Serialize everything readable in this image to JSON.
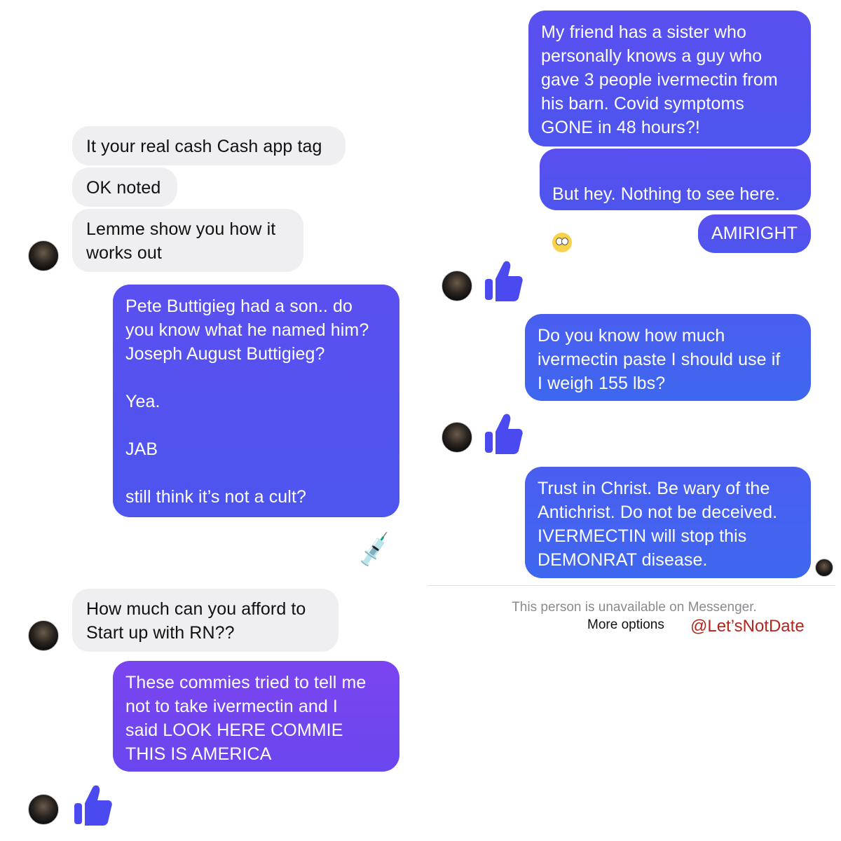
{
  "left": {
    "incoming": [
      {
        "text": "It your real cash Cash app tag"
      },
      {
        "text": "OK noted"
      },
      {
        "text": "Lemme show you how it\nworks out"
      },
      {
        "text": "How much can you afford to\nStart up with RN??"
      }
    ],
    "outgoing": [
      {
        "text": "Pete Buttigieg had a son.. do\nyou know what he named him?\nJoseph August Buttigieg?\n\nYea.\n\nJAB\n\nstill think it’s not a cult?"
      },
      {
        "text": "These commies tried to tell me\nnot to take ivermectin and I\nsaid LOOK HERE COMMIE\nTHIS IS AMERICA"
      }
    ],
    "syringe_emoji": "💉"
  },
  "right": {
    "outgoing": [
      {
        "text": "My friend has a sister who\npersonally knows a guy who\ngave 3 people ivermectin from\nhis barn. Covid symptoms\nGONE in 48 hours?!"
      },
      {
        "text": "But hey. Nothing to see here."
      },
      {
        "text": "AMIRIGHT"
      },
      {
        "text": "Do you know how much\nivermectin paste I should use if\nI weigh 155 lbs?"
      },
      {
        "text": "Trust in Christ. Be wary of the\nAntichrist. Do not be deceived.\nIVERMECTIN will stop this\nDEMONRAT disease."
      }
    ],
    "eye_roll_emoji": "🙄",
    "notice": "This person is unavailable on Messenger.",
    "more_options": "More options"
  },
  "watermark": "@Let’sNotDate",
  "colors": {
    "incoming_bg": "#efeff1",
    "outgoing_start": "#5b4ff0",
    "outgoing_end": "#4d55ee",
    "thumb": "#4b49f0",
    "watermark": "#b3261e"
  },
  "icons": [
    "avatar",
    "thumbs-up-icon",
    "syringe-emoji",
    "eye-roll-emoji"
  ]
}
